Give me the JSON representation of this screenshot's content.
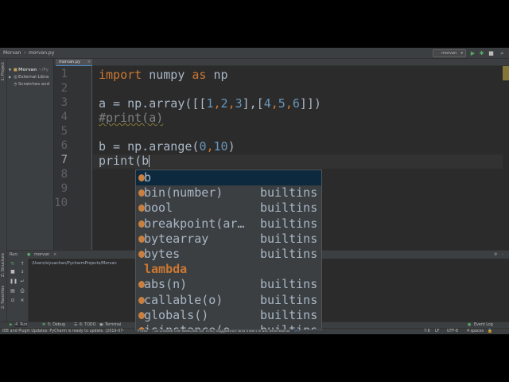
{
  "navbar": {
    "project": "Morvan",
    "file": "morvan.py",
    "run_config": "morvan"
  },
  "toolbar": {
    "run_icon": "play-icon",
    "debug_icon": "bug-icon",
    "search_icon": "search-icon"
  },
  "left_stripe": {
    "project": "1: Project",
    "structure": "Z: Structure",
    "favorites": "2: Favorites"
  },
  "project_tree": {
    "items": [
      {
        "label": "Morvan",
        "suffix": "~/Py"
      },
      {
        "label": "External Libra"
      },
      {
        "label": "Scratches and"
      }
    ]
  },
  "tab": {
    "label": "morvan.py"
  },
  "gutter": {
    "lines": [
      "1",
      "2",
      "3",
      "4",
      "5",
      "6",
      "7",
      "8",
      "9",
      "10"
    ]
  },
  "code": {
    "l1_kw1": "import",
    "l1_mod": " numpy ",
    "l1_kw2": "as",
    "l1_alias": " np",
    "l3_a": "a = np.array([[",
    "l3_n1": "1",
    "l3_n2": "2",
    "l3_n3": "3",
    "l3_mid": "],[",
    "l3_n4": "4",
    "l3_n5": "5",
    "l3_n6": "6",
    "l3_end": "]])",
    "l3_comma": ",",
    "l4_comment": "#print(a)",
    "l6_a": "b = np.arange(",
    "l6_n1": "0",
    "l6_n2": "10",
    "l6_end": ")",
    "l7_a": "print(b"
  },
  "completion": {
    "items": [
      {
        "name": "b",
        "source": ""
      },
      {
        "name": "bin(number)",
        "source": "builtins"
      },
      {
        "name": "bool",
        "source": "builtins"
      },
      {
        "name": "breakpoint(ar…",
        "source": "builtins"
      },
      {
        "name": "bytearray",
        "source": "builtins"
      },
      {
        "name": "bytes",
        "source": "builtins"
      },
      {
        "name": "lambda",
        "source": ""
      },
      {
        "name": "abs(n)",
        "source": "builtins"
      },
      {
        "name": "callable(o)",
        "source": "builtins"
      },
      {
        "name": "globals()",
        "source": "builtins"
      },
      {
        "name": "isinstance(o…",
        "source": "builtins"
      }
    ]
  },
  "run_panel": {
    "label": "Run:",
    "config": "morvan",
    "output": "/Users/siyuanhan/PycharmProjects/Morvan"
  },
  "tool_tabs": {
    "run": "4: Run",
    "debug": "5: Debug",
    "todo": "6: TODO",
    "terminal": "Terminal",
    "event_log": "Event Log"
  },
  "status": {
    "message": "IDE and Plugin Updates: PyCharm is ready to update. (2019-07-",
    "hint": "Press ^. to choose the selected (or first) suggestion and insert a dot afterwards",
    "hint_link": ">>",
    "position": "7:8",
    "line_sep": "LF",
    "encoding": "UTF-8",
    "indent": "4 spaces"
  },
  "colors": {
    "bg": "#2b2b2b",
    "keyword": "#cc7832",
    "number": "#6897bb",
    "text": "#a9b7c6",
    "panel": "#3c3f41"
  }
}
